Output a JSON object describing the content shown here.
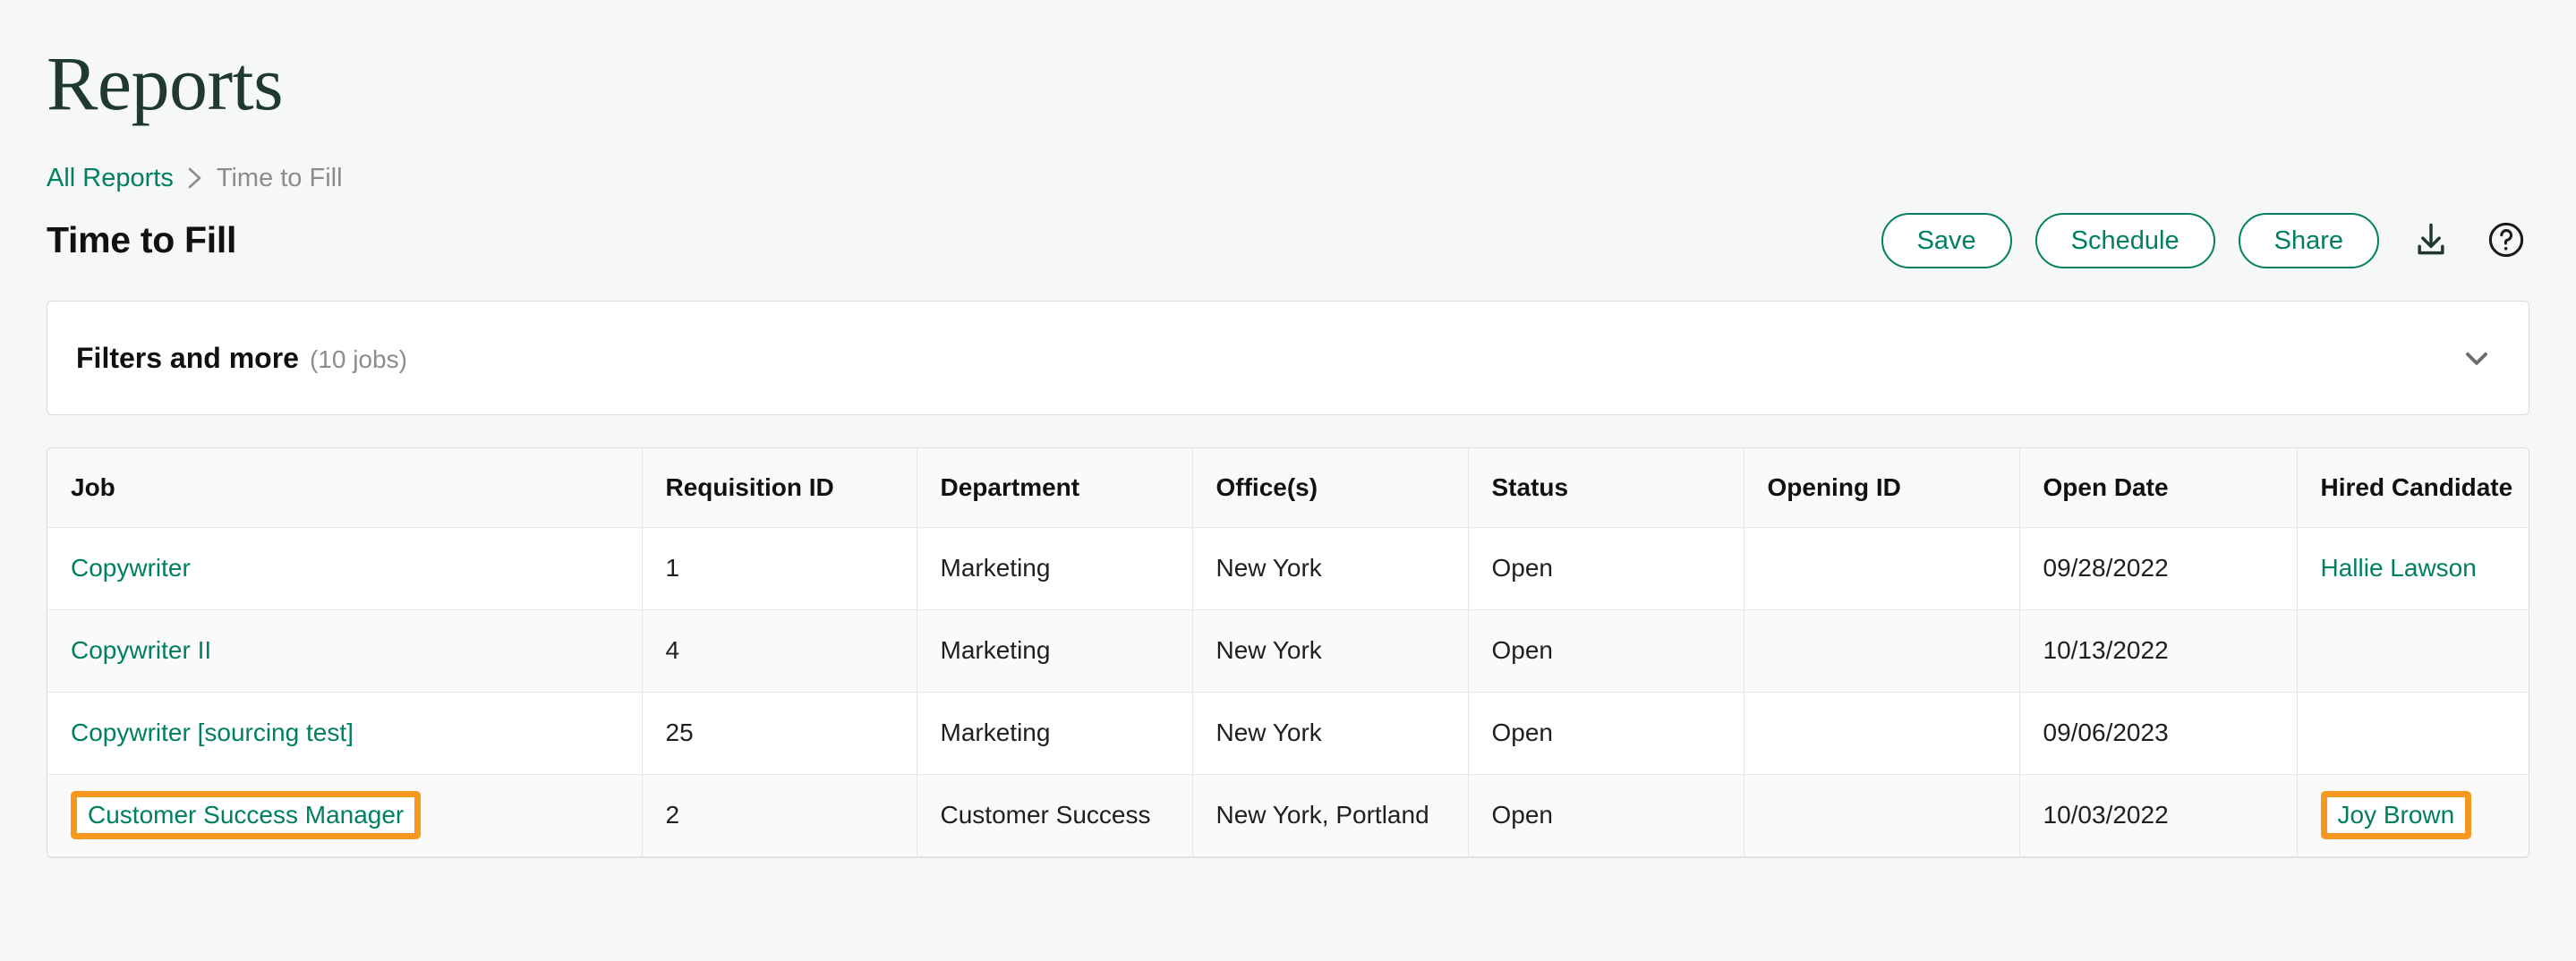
{
  "page": {
    "title": "Reports"
  },
  "breadcrumb": {
    "root_label": "All Reports",
    "separator": "›",
    "current_label": "Time to Fill"
  },
  "report": {
    "title": "Time to Fill"
  },
  "actions": {
    "save_label": "Save",
    "schedule_label": "Schedule",
    "share_label": "Share",
    "download_icon": "download-icon",
    "help_icon": "help-circle-icon"
  },
  "filters": {
    "label": "Filters and more",
    "count_label": "(10 jobs)",
    "chevron_icon": "chevron-down-icon"
  },
  "table": {
    "columns": [
      "Job",
      "Requisition ID",
      "Department",
      "Office(s)",
      "Status",
      "Opening ID",
      "Open Date",
      "Hired Candidate"
    ],
    "rows": [
      {
        "job": "Copywriter",
        "requisition_id": "1",
        "department": "Marketing",
        "offices": "New York",
        "status": "Open",
        "opening_id": "",
        "open_date": "09/28/2022",
        "hired_candidate": "Hallie Lawson"
      },
      {
        "job": "Copywriter II",
        "requisition_id": "4",
        "department": "Marketing",
        "offices": "New York",
        "status": "Open",
        "opening_id": "",
        "open_date": "10/13/2022",
        "hired_candidate": ""
      },
      {
        "job": "Copywriter [sourcing test]",
        "requisition_id": "25",
        "department": "Marketing",
        "offices": "New York",
        "status": "Open",
        "opening_id": "",
        "open_date": "09/06/2023",
        "hired_candidate": ""
      },
      {
        "job": "Customer Success Manager",
        "requisition_id": "2",
        "department": "Customer Success",
        "offices": "New York, Portland",
        "status": "Open",
        "opening_id": "",
        "open_date": "10/03/2022",
        "hired_candidate": "Joy Brown"
      }
    ]
  },
  "colors": {
    "brand_green": "#008060",
    "title_green": "#20392e",
    "highlight_orange": "#f5981d",
    "muted_text": "#8c8c8c",
    "page_background": "#f6f7f7"
  }
}
